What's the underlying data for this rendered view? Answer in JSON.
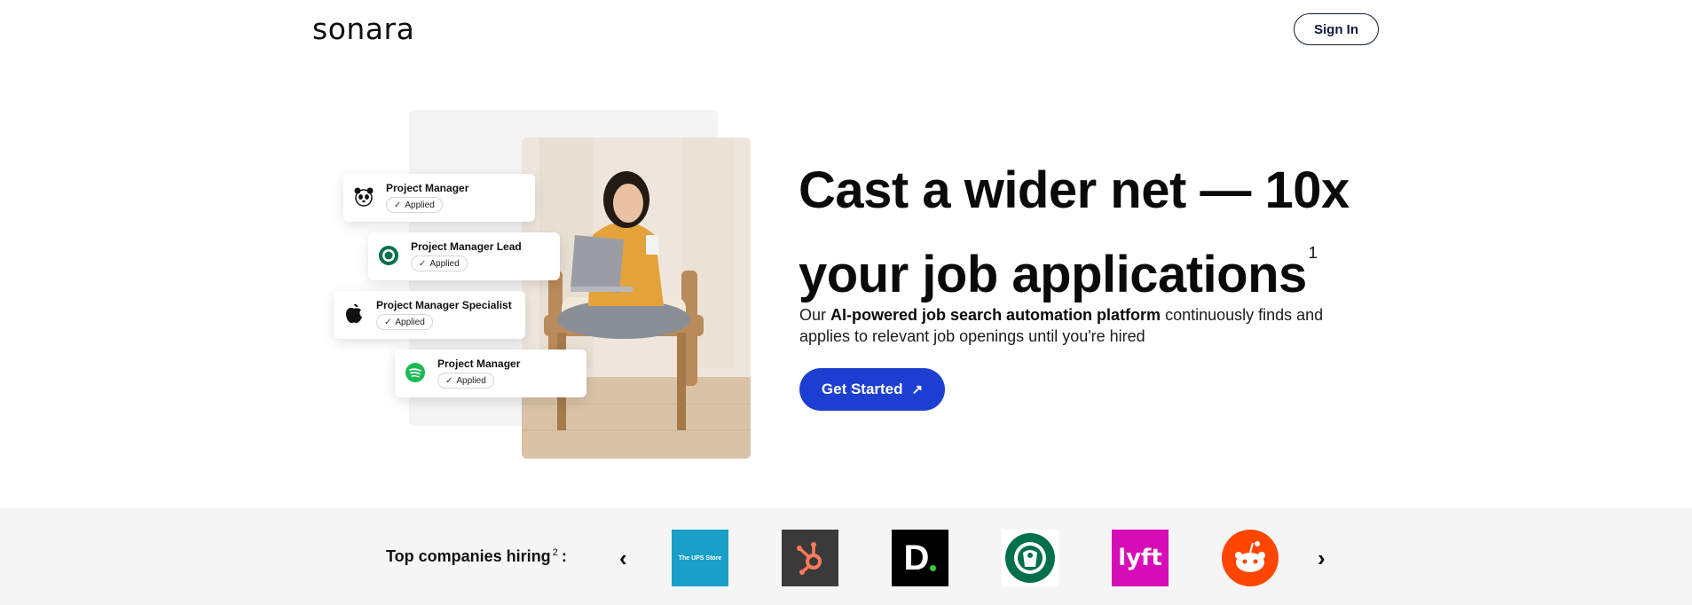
{
  "header": {
    "logo": "sonara",
    "signin_label": "Sign In"
  },
  "hero": {
    "headline": "Cast a wider net — 10x your job applications",
    "headline_sup": "1",
    "subtitle_prefix": "Our ",
    "subtitle_bold": "AI-powered job search automation platform",
    "subtitle_suffix": " continuously finds and applies to relevant job openings until you're hired",
    "cta_label": "Get Started",
    "cards": [
      {
        "title": "Project Manager",
        "status": "Applied",
        "logo": "wwf-panda-icon"
      },
      {
        "title": "Project Manager Lead",
        "status": "Applied",
        "logo": "starbucks-icon"
      },
      {
        "title": "Project Manager Specialist",
        "status": "Applied",
        "logo": "apple-icon"
      },
      {
        "title": "Project Manager",
        "status": "Applied",
        "logo": "spotify-icon"
      }
    ]
  },
  "companies": {
    "label": "Top companies hiring",
    "label_sup": "2",
    "label_colon": ":",
    "logos": [
      {
        "name": "the-ups-store-logo",
        "text": "The UPS Store",
        "color": "#1a9fc9"
      },
      {
        "name": "hubspot-logo",
        "text": "",
        "color": "#3a3a3a"
      },
      {
        "name": "doordash-d-logo",
        "text": "D",
        "color": "#000000"
      },
      {
        "name": "starbucks-logo",
        "text": "",
        "color": "#00704a"
      },
      {
        "name": "lyft-logo",
        "text": "lyft",
        "color": "#d60db7"
      },
      {
        "name": "reddit-logo",
        "text": "",
        "color": "#ff4500"
      }
    ]
  },
  "colors": {
    "primary": "#1d3fd1",
    "strip_bg": "#f5f5f5"
  }
}
